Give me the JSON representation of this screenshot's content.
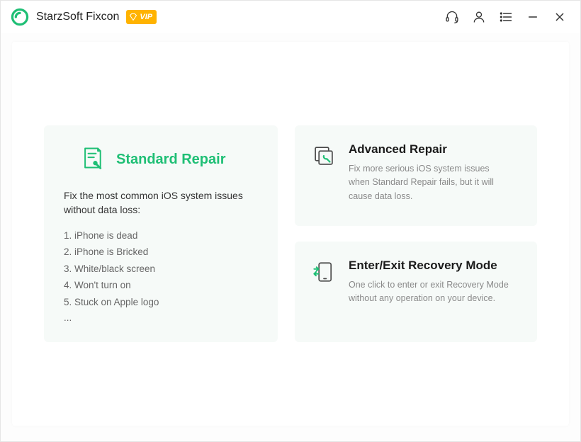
{
  "header": {
    "title": "StarzSoft Fixcon",
    "vip_label": "VIP"
  },
  "standard": {
    "title": "Standard Repair",
    "subtitle": "Fix the most common iOS system issues without data loss:",
    "items": [
      "1. iPhone is dead",
      "2. iPhone is Bricked",
      "3. White/black screen",
      "4. Won't turn on",
      "5. Stuck on Apple logo"
    ],
    "ellipsis": "..."
  },
  "advanced": {
    "title": "Advanced Repair",
    "desc": "Fix more serious iOS system issues when Standard Repair fails, but it will cause data loss."
  },
  "recovery": {
    "title": "Enter/Exit Recovery Mode",
    "desc": "One click to enter or exit Recovery Mode without any operation on your device."
  }
}
